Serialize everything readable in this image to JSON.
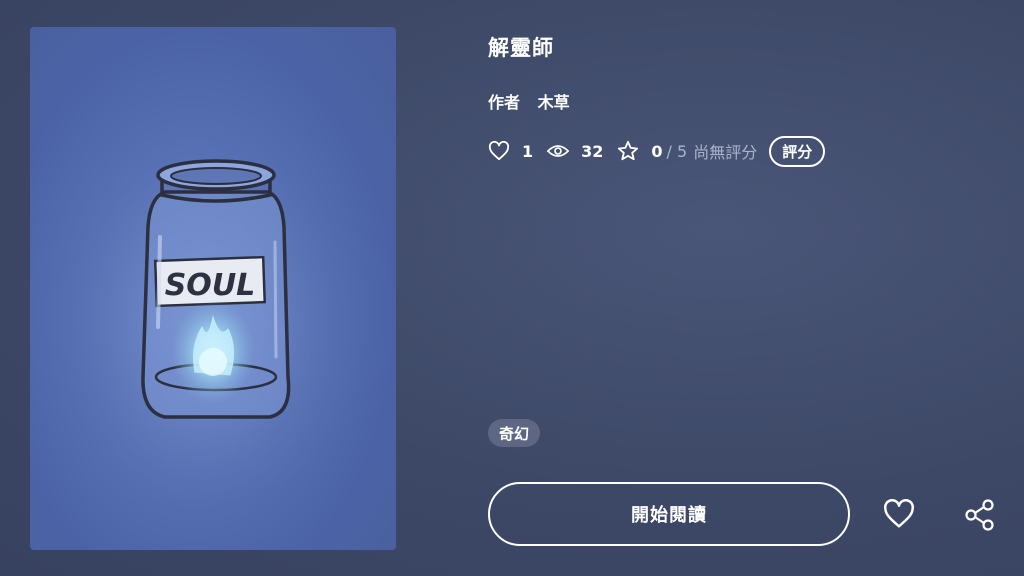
{
  "book": {
    "title": "解靈師",
    "author_label": "作者",
    "author_name": "木草",
    "cover_label_text": "SOUL"
  },
  "stats": {
    "likes": "1",
    "views": "32",
    "rating": "0",
    "rating_max": "/ 5",
    "rating_status": "尚無評分",
    "rate_button": "評分"
  },
  "tags": [
    "奇幻"
  ],
  "actions": {
    "start_reading": "開始閱讀"
  },
  "colors": {
    "background": "#3f4a68",
    "cover_blue": "#5670b3",
    "tag_bg": "#5d6783",
    "muted_text": "#aab3c9"
  },
  "icons": [
    "heart-icon",
    "eye-icon",
    "star-icon",
    "heart-outline-icon",
    "share-icon"
  ]
}
